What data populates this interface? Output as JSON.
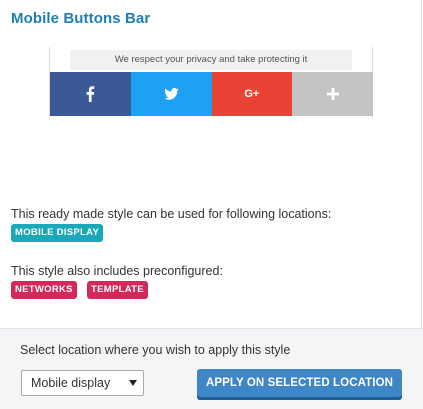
{
  "header": {
    "title": "Mobile Buttons Bar"
  },
  "preview": {
    "privacy_text": "We respect your privacy and take protecting it",
    "buttons": [
      {
        "name": "facebook",
        "icon": "facebook-icon",
        "glyph": "f",
        "color": "#3b5998"
      },
      {
        "name": "twitter",
        "icon": "twitter-icon",
        "glyph": "",
        "color": "#1da1f2"
      },
      {
        "name": "google-plus",
        "icon": "google-plus-icon",
        "glyph": "G+",
        "color": "#ea4335"
      },
      {
        "name": "more",
        "icon": "plus-icon",
        "glyph": "+",
        "color": "#c4c4c4"
      }
    ]
  },
  "locations": {
    "description": "This ready made style can be used for following locations:",
    "tags": [
      "MOBILE DISPLAY"
    ]
  },
  "preconfigured": {
    "description": "This style also includes preconfigured:",
    "tags": [
      "NETWORKS",
      "TEMPLATE"
    ]
  },
  "footer": {
    "label": "Select location where you wish to apply this style",
    "select_value": "Mobile display",
    "apply_label": "APPLY ON SELECTED LOCATION"
  },
  "colors": {
    "title": "#1f7fb3",
    "tag_location": "#1ba8b9",
    "tag_preconfigured": "#d3295a",
    "apply_button": "#3e86c6"
  }
}
